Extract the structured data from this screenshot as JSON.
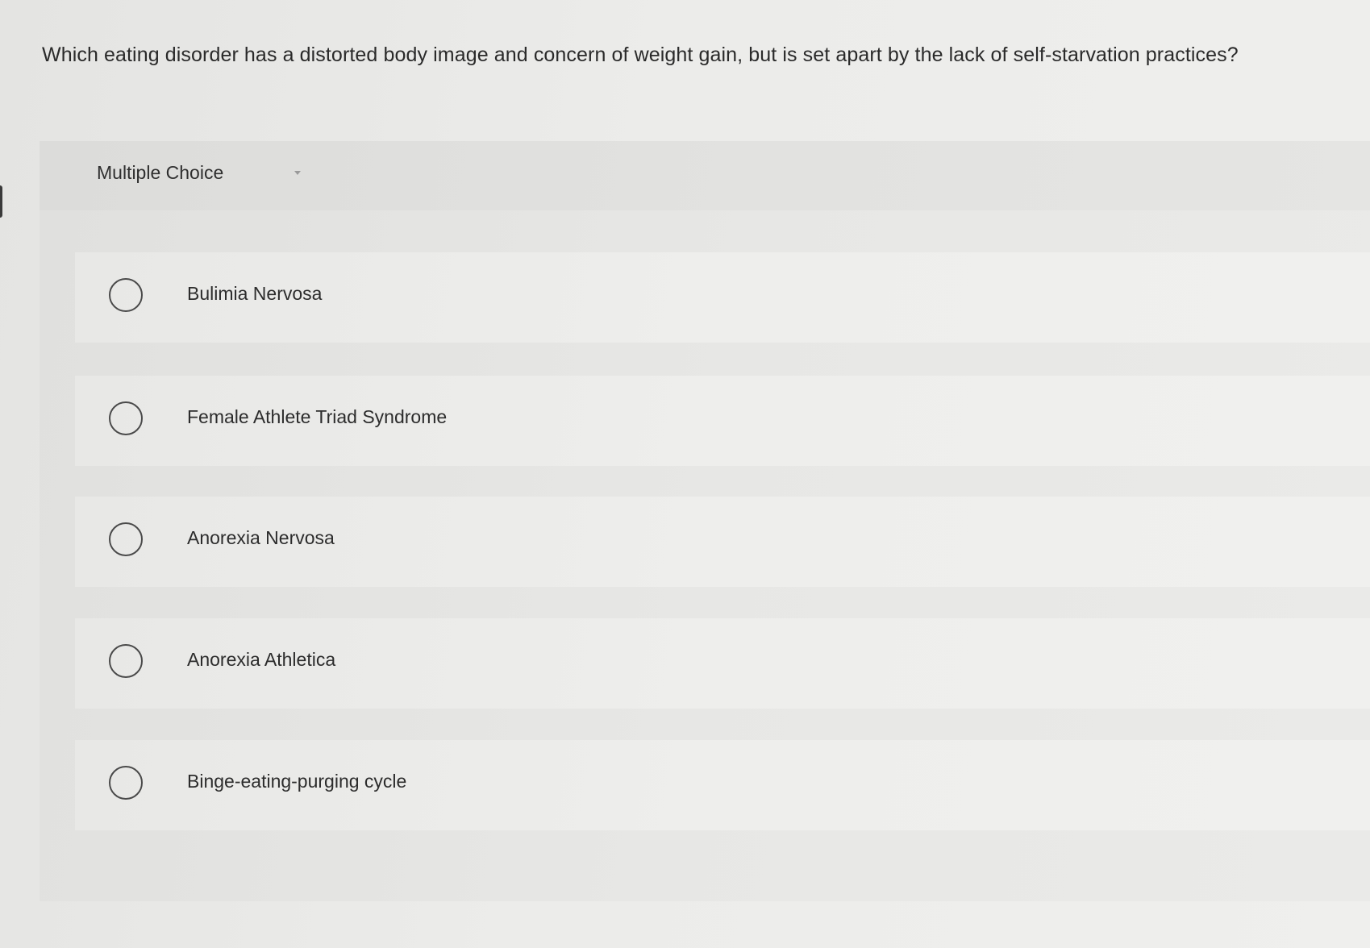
{
  "question": {
    "text": "Which eating disorder has a distorted body image and concern of weight gain, but is set apart by the lack of self-starvation practices?"
  },
  "multiple_choice": {
    "header_label": "Multiple Choice",
    "options": [
      {
        "label": "Bulimia Nervosa",
        "selected": false
      },
      {
        "label": "Female Athlete Triad Syndrome",
        "selected": false
      },
      {
        "label": "Anorexia Nervosa",
        "selected": false
      },
      {
        "label": "Anorexia Athletica",
        "selected": false
      },
      {
        "label": "Binge-eating-purging cycle",
        "selected": false
      }
    ]
  },
  "icons": {
    "radio": "radio-button-icon",
    "caret": "chevron-down-icon"
  }
}
